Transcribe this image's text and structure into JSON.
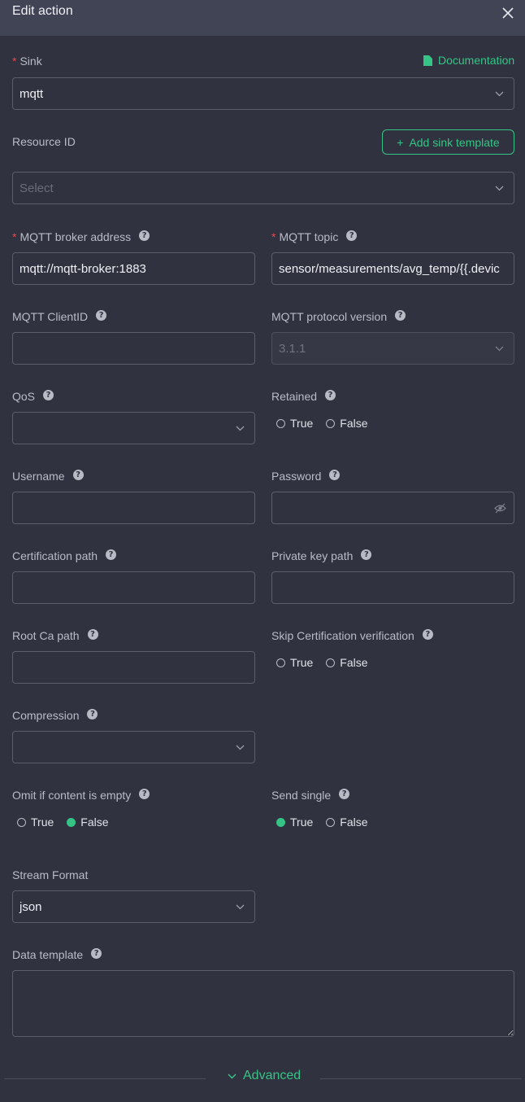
{
  "header": {
    "title": "Edit action"
  },
  "sink": {
    "label": "Sink",
    "value": "mqtt",
    "doc_link": "Documentation"
  },
  "resource": {
    "label": "Resource ID",
    "placeholder": "Select",
    "add_button": "Add sink template"
  },
  "broker": {
    "label": "MQTT broker address",
    "value": "mqtt://mqtt-broker:1883"
  },
  "topic": {
    "label": "MQTT topic",
    "value": "sensor/measurements/avg_temp/{{.devic"
  },
  "clientid": {
    "label": "MQTT ClientID",
    "value": ""
  },
  "protocol": {
    "label": "MQTT protocol version",
    "value": "3.1.1"
  },
  "qos": {
    "label": "QoS",
    "value": ""
  },
  "retained": {
    "label": "Retained",
    "options": [
      "True",
      "False"
    ],
    "selected": null
  },
  "username": {
    "label": "Username",
    "value": ""
  },
  "password": {
    "label": "Password",
    "value": ""
  },
  "certpath": {
    "label": "Certification path",
    "value": ""
  },
  "keypath": {
    "label": "Private key path",
    "value": ""
  },
  "rootca": {
    "label": "Root Ca path",
    "value": ""
  },
  "skipcert": {
    "label": "Skip Certification verification",
    "options": [
      "True",
      "False"
    ],
    "selected": null
  },
  "compression": {
    "label": "Compression",
    "value": ""
  },
  "omit": {
    "label": "Omit if content is empty",
    "options": [
      "True",
      "False"
    ],
    "selected": "False"
  },
  "sendsingle": {
    "label": "Send single",
    "options": [
      "True",
      "False"
    ],
    "selected": "True"
  },
  "streamformat": {
    "label": "Stream Format",
    "value": "json"
  },
  "datatemplate": {
    "label": "Data template",
    "value": ""
  },
  "advanced": {
    "label": "Advanced"
  },
  "colors": {
    "accent": "#35c486",
    "required": "#e5484d",
    "background": "#30323f",
    "header": "#414454"
  }
}
